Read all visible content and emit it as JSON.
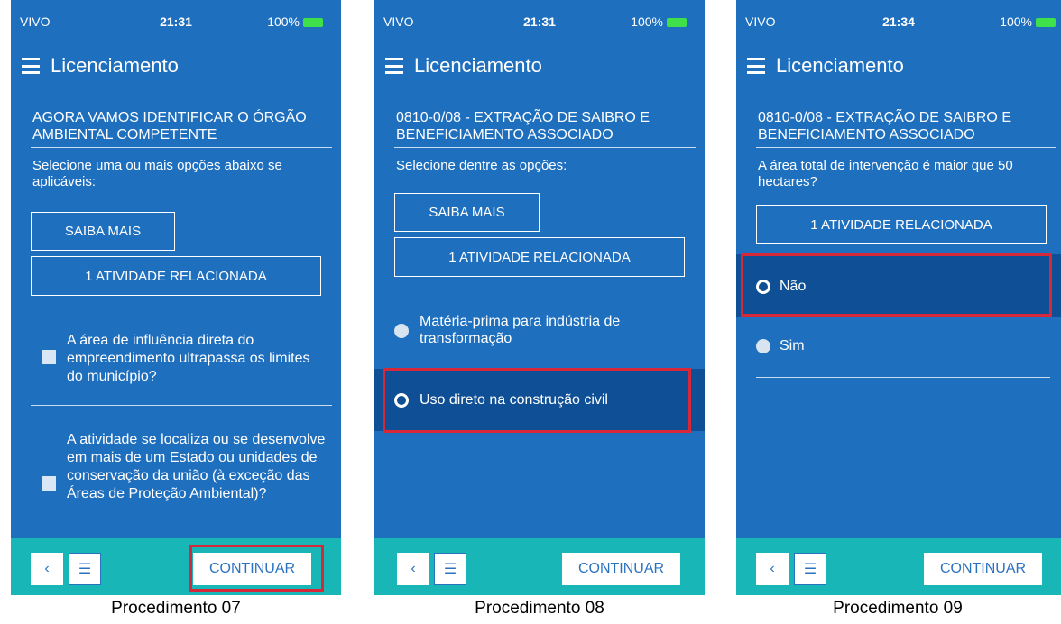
{
  "status": {
    "carrier": "VIVO",
    "battery": "100%"
  },
  "app_title": "Licenciamento",
  "screens": [
    {
      "time": "21:31",
      "heading": "AGORA VAMOS IDENTIFICAR O ÓRGÃO AMBIENTAL COMPETENTE",
      "subtitle": "Selecione uma ou mais opções abaixo se aplicáveis:",
      "saiba_mais": "SAIBA MAIS",
      "atividade": "1 ATIVIDADE RELACIONADA",
      "checkboxes": [
        {
          "label": "A área de influência direta do empreendimento ultrapassa os limites do município?",
          "checked": false
        },
        {
          "label": "A atividade se localiza ou se desenvolve em mais de um Estado ou unidades de conservação da união (à exceção das Áreas de Proteção Ambiental)?",
          "checked": false
        }
      ],
      "continue": "CONTINUAR",
      "caption": "Procedimento 07"
    },
    {
      "time": "21:31",
      "heading": "0810-0/08 - EXTRAÇÃO DE SAIBRO E BENEFICIAMENTO ASSOCIADO",
      "subtitle": "Selecione dentre as opções:",
      "saiba_mais": "SAIBA MAIS",
      "atividade": "1 ATIVIDADE RELACIONADA",
      "options": [
        {
          "label": "Matéria-prima para indústria de transformação",
          "selected": false
        },
        {
          "label": "Uso direto na construção civil",
          "selected": true
        }
      ],
      "continue": "CONTINUAR",
      "caption": "Procedimento 08"
    },
    {
      "time": "21:34",
      "heading": "0810-0/08 - EXTRAÇÃO DE SAIBRO E BENEFICIAMENTO ASSOCIADO",
      "subtitle": "A área total de intervenção é maior que 50 hectares?",
      "atividade": "1 ATIVIDADE RELACIONADA",
      "options": [
        {
          "label": "Não",
          "selected": true
        },
        {
          "label": "Sim",
          "selected": false
        }
      ],
      "continue": "CONTINUAR",
      "caption": "Procedimento 09"
    }
  ],
  "colors": {
    "background": "#1f6fbf",
    "footer": "#18b6b6",
    "highlight": "#0f4f95",
    "annotation": "#d7283a"
  }
}
